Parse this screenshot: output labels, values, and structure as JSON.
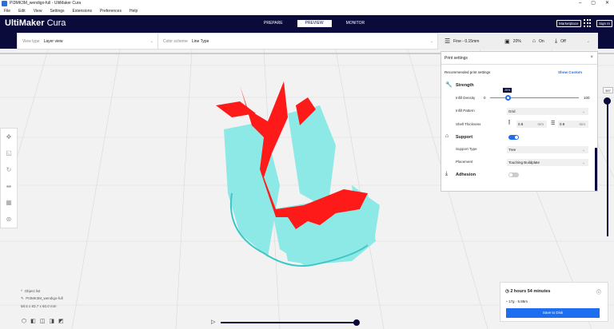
{
  "window": {
    "title": "PI3MK3M_wendigo-full - UltiMaker Cura",
    "controls": [
      "–",
      "▢",
      "✕"
    ]
  },
  "menu": [
    "File",
    "Edit",
    "View",
    "Settings",
    "Extensions",
    "Preferences",
    "Help"
  ],
  "header": {
    "logo_bold": "UltiMaker",
    "logo_light": " Cura",
    "stages": [
      "PREPARE",
      "PREVIEW",
      "MONITOR"
    ],
    "active_stage": "PREVIEW",
    "marketplace": "Marketplace",
    "sign_in": "Sign In"
  },
  "toolbar": {
    "view_type_label": "View type",
    "view_type_value": "Layer view",
    "color_scheme_label": "Color scheme",
    "color_scheme_value": "Line Type"
  },
  "print_summary": {
    "profile": "Fine - 0.15mm",
    "infill": "20%",
    "support": "On",
    "adhesion": "Off"
  },
  "print_settings": {
    "title": "Print settings",
    "recommended": "Recommended print settings",
    "show_custom": "Show Custom",
    "strength": "Strength",
    "infill_density_label": "Infill Density",
    "infill_min": "0",
    "infill_max": "100",
    "infill_value": "20%",
    "infill_fraction": 0.2,
    "infill_pattern_label": "Infill Pattern",
    "infill_pattern": "Grid",
    "shell_thickness_label": "Shell Thickness",
    "wall": "0.8",
    "top_bottom": "0.8",
    "unit": "mm",
    "support": "Support",
    "support_on": true,
    "support_type_label": "Support Type",
    "support_type": "Tree",
    "placement_label": "Placement",
    "placement": "Touching Buildplate",
    "adhesion": "Adhesion",
    "adhesion_on": false
  },
  "layer": {
    "current": "397"
  },
  "object": {
    "list_label": "Object list",
    "name": "PI3MK3M_wendigo-full",
    "dimensions": "58.5 x 83.7 x 60.0 mm"
  },
  "estimate": {
    "time": "2 hours 54 minutes",
    "material": "17g · 5.85m",
    "save": "Save to Disk"
  },
  "colors": {
    "header": "#0b0b3b",
    "accent": "#1e6ff0",
    "model_shell": "#ff1a1a",
    "support": "#7fe8e8"
  }
}
